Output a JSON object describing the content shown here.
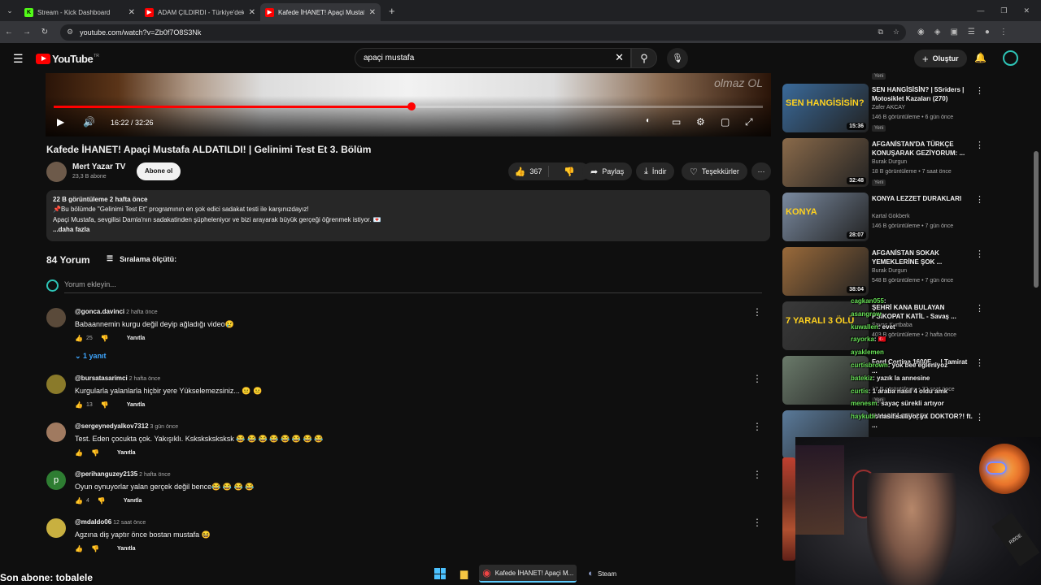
{
  "browser": {
    "tabs": [
      {
        "label": "Stream - Kick Dashboard",
        "favicon": "K",
        "color": "#53fc18"
      },
      {
        "label": "ADAM ÇILDIRDI - Türkiye'deki Y...",
        "favicon": "▶",
        "color": "#ff0000"
      },
      {
        "label": "Kafede İHANET! Apaçi Mustafa...",
        "favicon": "▶",
        "color": "#ff0000"
      }
    ],
    "url": "youtube.com/watch?v=Zb0f7O8S3Nk"
  },
  "header": {
    "logo": "YouTube",
    "country": "TR",
    "search_value": "apaçi mustafa",
    "create_label": "Oluştur"
  },
  "player": {
    "time": "16:22 / 32:26",
    "progress": 0.5046,
    "watermark": "olmaz OL"
  },
  "video": {
    "title": "Kafede İHANET! Apaçi Mustafa ALDATILDI! | Gelinimi Test Et 3. Bölüm",
    "channel": "Mert Yazar TV",
    "subs": "23,3 B abone",
    "subscribe": "Abone ol",
    "likes": "367",
    "share": "Paylaş",
    "download": "İndir",
    "thanks": "Teşekkürler"
  },
  "description": {
    "stats": "22 B görüntüleme  2 hafta önce",
    "line1": "📌Bu bölümde \"Gelinimi Test Et\" programının en şok edici sadakat testi ile karşınızdayız!",
    "line2": "Apaçi Mustafa, sevgilisi Damla'nın sadakatinden şüpheleniyor ve bizi arayarak büyük gerçeği öğrenmek istiyor. 💌",
    "more": "...daha fazla"
  },
  "comments": {
    "count": "84 Yorum",
    "sort": "Sıralama ölçütü:",
    "add_placeholder": "Yorum ekleyin...",
    "reply_label": "Yanıtla",
    "replies_toggle": "1 yanıt",
    "items": [
      {
        "user": "@gonca.davinci",
        "time": "2 hafta önce",
        "text": "Babaannemin kurgu değil deyip ağladığı video😢",
        "likes": "25",
        "avatar": "#5a4a3a"
      },
      {
        "user": "@bursatasarimci",
        "time": "2 hafta önce",
        "text": "Kurgularla yalanlarla hiçbir yere Yükselemezsiniz... 😐 😐",
        "likes": "13",
        "avatar": "#8a7a2a"
      },
      {
        "user": "@sergeynedyalkov7312",
        "time": "3 gün önce",
        "text": "Test. Eden çocukta çok. Yakışıklı. Ksksksksksksk 😂 😂 😂 😂 😂 😂 😂 😂",
        "likes": "",
        "avatar": "#a07a60"
      },
      {
        "user": "@perihanguzey2135",
        "time": "2 hafta önce",
        "text": "Oyun oynuyorlar yalan gerçek değil bence😂 😂 😂 😂",
        "likes": "4",
        "avatar": "#2e7d32",
        "initial": "p"
      },
      {
        "user": "@mdaldo06",
        "time": "12 saat önce",
        "text": "Agzına diş yaptır önce bostan mustafa 😆",
        "likes": "",
        "avatar": "#c8b040"
      }
    ]
  },
  "sidebar": {
    "top_badge": "Yeni",
    "videos": [
      {
        "title": "SEN HANGİSİSİN? | 5Sriders | Motosiklet Kazaları (270)",
        "channel": "Zafer AKCAY",
        "meta": "146 B görüntüleme • 6 gün önce",
        "duration": "15:36",
        "badge": "Yeni",
        "overlay": "SEN HANGİSİSİN?",
        "bg": "#3a6a9a"
      },
      {
        "title": "AFGANİSTAN'DA TÜRKÇE KONUŞARAK GEZİYORUM: ...",
        "channel": "Burak Durgun",
        "meta": "18 B görüntüleme • 7 saat önce",
        "duration": "32:48",
        "badge": "Yeni",
        "overlay": "",
        "bg": "#8a6a4a"
      },
      {
        "title": "KONYA LEZZET DURAKLARI",
        "channel": "Kartal Gökberk",
        "meta": "146 B görüntüleme • 7 gün önce",
        "duration": "28:07",
        "badge": "",
        "overlay": "KONYA",
        "bg": "#7a8aa0"
      },
      {
        "title": "AFGANİSTAN SOKAK YEMEKLERİNE ŞOK ...",
        "channel": "Burak Durgun",
        "meta": "548 B görüntüleme • 7 gün önce",
        "duration": "38:04",
        "badge": "",
        "overlay": "",
        "bg": "#9a6a3a"
      },
      {
        "title": "ŞEHRİ KANA BULAYAN PSİKOPAT KATİL - Savaş ...",
        "channel": "Savaş Kurtbaba",
        "meta": "403 B görüntüleme • 2 hafta önce",
        "duration": "",
        "badge": "",
        "overlay": "7 YARALI 3 ÖLÜ",
        "bg": "#3a3a3a"
      },
      {
        "title": "Ford Cortina 1600E ... | Tamirat ...",
        "channel": "",
        "meta": "17 B görüntüleme • 22 saat önce",
        "duration": "",
        "badge": "Yeni",
        "overlay": "",
        "bg": "#6a7a6a"
      },
      {
        "title": "HANGİSİ GERÇEK DOKTOR?! ft. ...",
        "channel": "",
        "meta": "",
        "duration": "",
        "badge": "",
        "overlay": "",
        "bg": "#5a7a9a"
      }
    ]
  },
  "chat": [
    {
      "name": "cagkan055",
      "msg": ": "
    },
    {
      "name": "asangrow",
      "msg": ""
    },
    {
      "name": "kuwallen",
      "msg": ": evet"
    },
    {
      "name": "rayorka",
      "msg": ": 🇹🇷"
    },
    {
      "name": "ayaklemen",
      "msg": ""
    },
    {
      "name": "curtisbrown",
      "msg": ": yok bee eğleniyoz"
    },
    {
      "name": "batekiz",
      "msg": ": yazık la annesine"
    },
    {
      "name": "curtis",
      "msg": ": 1 araba nasıl 4 oldu amk"
    },
    {
      "name": "menesm",
      "msg": ": sayaç sürekli artıyor"
    },
    {
      "name": "haykubi",
      "msg": ": nasıl sallıyor ya"
    }
  ],
  "stream": {
    "last_sub": "Son abone: tobalele",
    "mic_brand": "RØDE"
  },
  "taskbar": {
    "chrome_label": "Kafede İHANET! Apaçi M...",
    "steam_label": "Steam"
  }
}
